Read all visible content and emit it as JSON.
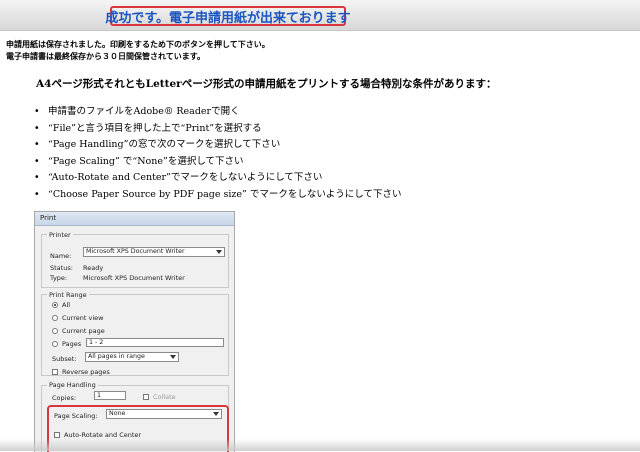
{
  "banner": {
    "message": "成功です。電子申請用紙が出来ております"
  },
  "notice": {
    "line1": "申請用紙は保存されました。印刷をするため下のボタンを押して下さい。",
    "line2": "電子申請書は最終保存から３０日間保管されています。"
  },
  "instructions": {
    "heading": "A4ページ形式それともLetterページ形式の申請用紙をプリントする場合特別な条件があります：",
    "steps": [
      "申請書のファイルをAdobe® Readerで開く",
      "“File”と言う項目を押した上で“Print”を選択する",
      "“Page Handling”の窓で次のマークを選択して下さい",
      "“Page Scaling” で“None”を選択して下さい",
      "“Auto-Rotate and Center”でマークをしないようにして下さい",
      "“Choose Paper Source by PDF page size” でマークをしないようにして下さい"
    ]
  },
  "print_dialog": {
    "title": "Print",
    "printer_group": "Printer",
    "name_label": "Name:",
    "name_value": "Microsoft XPS Document Writer",
    "status_label": "Status:",
    "status_value": "Ready",
    "type_label": "Type:",
    "type_value": "Microsoft XPS Document Writer",
    "range_group": "Print Range",
    "range_all": "All",
    "range_current_view": "Current view",
    "range_current_page": "Current page",
    "range_pages": "Pages",
    "pages_value": "1 - 2",
    "subset_label": "Subset:",
    "subset_value": "All pages in range",
    "reverse_pages": "Reverse pages",
    "handling_group": "Page Handling",
    "copies_label": "Copies:",
    "copies_value": "1",
    "collate_label": "Collate",
    "scaling_label": "Page Scaling:",
    "scaling_value": "None",
    "auto_rotate": "Auto-Rotate and Center"
  },
  "colors": {
    "highlight_border": "#d9363e",
    "banner_text": "#1a55c2"
  }
}
